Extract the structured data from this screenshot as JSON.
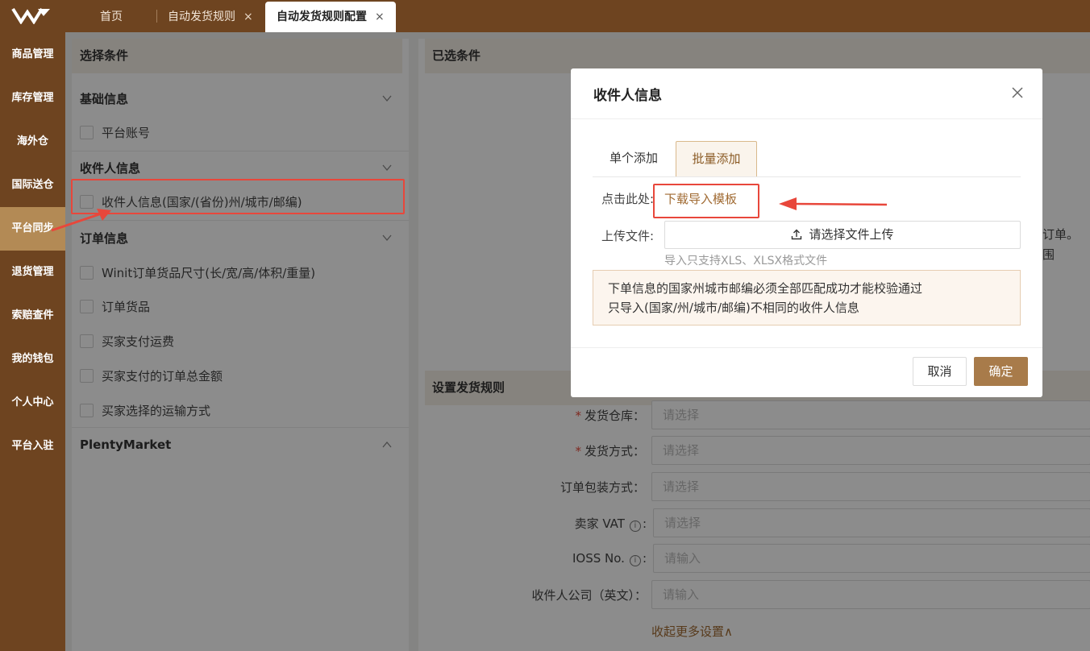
{
  "header": {
    "tabs": [
      {
        "label": "首页",
        "closable": false,
        "active": false
      },
      {
        "label": "自动发货规则",
        "closable": true,
        "active": false
      },
      {
        "label": "自动发货规则配置",
        "closable": true,
        "active": true
      }
    ],
    "close_glyph": "×"
  },
  "sidebar": {
    "items": [
      {
        "label": "商品管理"
      },
      {
        "label": "库存管理"
      },
      {
        "label": "海外仓"
      },
      {
        "label": "国际送仓"
      },
      {
        "label": "平台同步",
        "active": true
      },
      {
        "label": "退货管理"
      },
      {
        "label": "索赔查件"
      },
      {
        "label": "我的钱包"
      },
      {
        "label": "个人中心"
      },
      {
        "label": "平台入驻"
      }
    ]
  },
  "left_panel": {
    "title": "选择条件",
    "groups": [
      {
        "title": "基础信息",
        "expanded": true,
        "items": [
          "平台账号"
        ]
      },
      {
        "title": "收件人信息",
        "expanded": true,
        "items": [
          "收件人信息(国家/(省份)州/城市/邮编)"
        ]
      },
      {
        "title": "订单信息",
        "expanded": true,
        "items": [
          "Winit订单货品尺寸(长/宽/高/体积/重量)",
          "订单货品",
          "买家支付运费",
          "买家支付的订单总金额",
          "买家选择的运输方式"
        ]
      },
      {
        "title": "PlentyMarket",
        "expanded": false,
        "items": []
      }
    ]
  },
  "right_panel": {
    "selected_title": "已选条件",
    "behind_text_1": "订单。",
    "behind_text_2": "围",
    "rules_title": "设置发货规则",
    "fields": [
      {
        "label": "发货仓库：",
        "placeholder": "请选择",
        "required": true
      },
      {
        "label": "发货方式：",
        "placeholder": "请选择",
        "required": true
      },
      {
        "label": "订单包装方式：",
        "placeholder": "请选择",
        "required": false
      },
      {
        "label": "卖家 VAT",
        "placeholder": "请选择",
        "required": false,
        "info": true
      },
      {
        "label": "IOSS No.",
        "placeholder": "请输入",
        "required": false,
        "info": true
      },
      {
        "label": "收件人公司（英文）：",
        "placeholder": "请输入",
        "required": false
      }
    ],
    "collapse_link": "收起更多设置∧",
    "required_mark": "*",
    "info_glyph": "i",
    "colon": ":"
  },
  "modal": {
    "title": "收件人信息",
    "tabs": [
      "单个添加",
      "批量添加"
    ],
    "active_tab": "批量添加",
    "download_prefix": "点击此处:",
    "download_link": "下载导入模板",
    "upload_label": "上传文件:",
    "upload_button": "请选择文件上传",
    "upload_hint": "导入只支持XLS、XLSX格式文件",
    "note_lines": [
      "下单信息的国家州城市邮编必须全部匹配成功才能校验通过",
      "只导入(国家/州/城市/邮编)不相同的收件人信息"
    ],
    "cancel": "取消",
    "confirm": "确定"
  },
  "colors": {
    "brand": "#6e4420",
    "sidebar_active": "#b38a55",
    "primary_button": "#a87b4a",
    "highlight": "#e8473b"
  },
  "icons": [
    "logo",
    "close-icon",
    "chevron-down-icon",
    "chevron-up-icon",
    "upload-icon",
    "info-icon",
    "arrow-annotation"
  ]
}
